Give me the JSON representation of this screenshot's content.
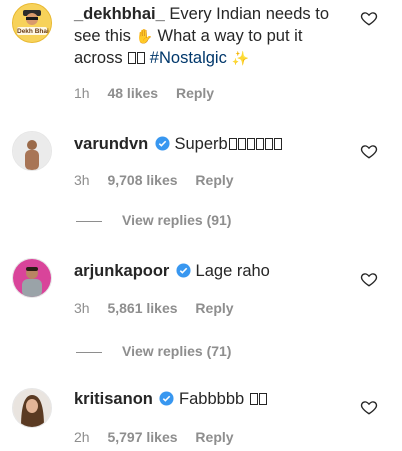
{
  "comments": [
    {
      "username": "_dekhbhai_",
      "verified": false,
      "text_line1": "Every Indian needs to",
      "text_line2": "see this",
      "text_line2b": "What a way to put it",
      "text_line3": "across",
      "hashtag": "#Nostalgic",
      "avatar_label": "Dekh Bhai",
      "time": "1h",
      "likes": "48 likes",
      "reply": "Reply"
    },
    {
      "username": "varundvn",
      "verified": true,
      "text": "Superb",
      "time": "3h",
      "likes": "9,708 likes",
      "reply": "Reply",
      "view_replies": "View replies (91)"
    },
    {
      "username": "arjunkapoor",
      "verified": true,
      "text": "Lage raho",
      "time": "3h",
      "likes": "5,861 likes",
      "reply": "Reply",
      "view_replies": "View replies (71)"
    },
    {
      "username": "kritisanon",
      "verified": true,
      "text": "Fabbbbb",
      "time": "2h",
      "likes": "5,797 likes",
      "reply": "Reply"
    }
  ],
  "colors": {
    "text": "#262626",
    "muted": "#8e8e8e",
    "verified": "#3897f0",
    "hashtag": "#00376b"
  }
}
